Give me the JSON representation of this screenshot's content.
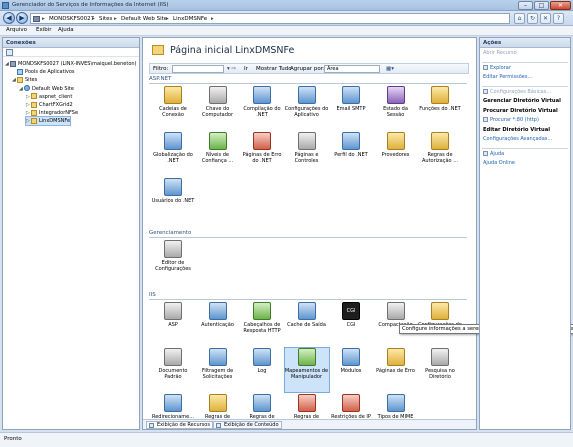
{
  "window": {
    "title": "Gerenciador do Serviços de Informações da Internet (IIS)"
  },
  "window_buttons": {
    "minimize": "–",
    "maximize": "□",
    "close": "✕"
  },
  "address": {
    "crumbs": [
      "MONDSKFS0027",
      "Sites",
      "Default Web Site",
      "LinxDMSNFe"
    ],
    "separator": "▸"
  },
  "menu": [
    "Arquivo",
    "Exibir",
    "Ajuda"
  ],
  "connections": {
    "title": "Conexões",
    "tree": [
      {
        "label": "MONDSKFS0027 (LINX-INVES\\maiquel.beneton)",
        "toggle": "◢",
        "icon": "server",
        "indent": 0
      },
      {
        "label": "Pools de Aplicativos",
        "toggle": "",
        "icon": "pools",
        "indent": 1
      },
      {
        "label": "Sites",
        "toggle": "◢",
        "icon": "folder",
        "indent": 1
      },
      {
        "label": "Default Web Site",
        "toggle": "◢",
        "icon": "globe",
        "indent": 2
      },
      {
        "label": "aspnet_client",
        "toggle": "▷",
        "icon": "folder",
        "indent": 3
      },
      {
        "label": "ChartFXGrid2",
        "toggle": "▷",
        "icon": "folder",
        "indent": 3
      },
      {
        "label": "IntegradorNFSe",
        "toggle": "▷",
        "icon": "folder",
        "indent": 3
      },
      {
        "label": "LinxDMSNFe",
        "toggle": "▷",
        "icon": "folder",
        "indent": 3,
        "selected": true
      }
    ]
  },
  "main": {
    "title": "Página inicial LinxDMSNFe",
    "filter_label": "Filtro:",
    "go_label": "Ir",
    "show_all_label": "Mostrar Tudo",
    "group_by_label": "Agrupar por:",
    "group_by_value": "Área",
    "groups": [
      {
        "name": "ASP.NET",
        "features": [
          {
            "label": "Cadeias de Conexão",
            "icon": "gold"
          },
          {
            "label": "Chave do Computador",
            "icon": "grey"
          },
          {
            "label": "Compilação do .NET",
            "icon": "blue"
          },
          {
            "label": "Configurações do Aplicativo",
            "icon": "blue"
          },
          {
            "label": "Email SMTP",
            "icon": "blue"
          },
          {
            "label": "Estado da Sessão",
            "icon": "purple"
          },
          {
            "label": "Funções do .NET",
            "icon": "gold"
          },
          {
            "label": "Globalização do .NET",
            "icon": "blue"
          },
          {
            "label": "Níveis de Confiança ...",
            "icon": "green"
          },
          {
            "label": "Páginas de Erro do .NET",
            "icon": "red"
          },
          {
            "label": "Páginas e Controles",
            "icon": "grey"
          },
          {
            "label": "Perfil do .NET",
            "icon": "blue"
          },
          {
            "label": "Provedores",
            "icon": "gold"
          },
          {
            "label": "Regras de Autorização ...",
            "icon": "gold"
          },
          {
            "label": "Usuários do .NET",
            "icon": "blue"
          }
        ]
      },
      {
        "name": "Gerenciamento",
        "features": [
          {
            "label": "Editor de Configurações",
            "icon": "grey"
          }
        ]
      },
      {
        "name": "IIS",
        "features": [
          {
            "label": "ASP",
            "icon": "grey"
          },
          {
            "label": "Autenticação",
            "icon": "blue"
          },
          {
            "label": "Cabeçalhos de Resposta HTTP",
            "icon": "green"
          },
          {
            "label": "Cache de Saída",
            "icon": "blue"
          },
          {
            "label": "CGI",
            "icon": "dark",
            "glyph": "CGI"
          },
          {
            "label": "Compactação",
            "icon": "grey"
          },
          {
            "label": "Configurações de SSL",
            "icon": "gold"
          },
          {
            "label": "Documento Padrão",
            "icon": "grey"
          },
          {
            "label": "Filtragem de Solicitações",
            "icon": "blue"
          },
          {
            "label": "Log",
            "icon": "blue"
          },
          {
            "label": "Mapeamentos de Manipulador",
            "icon": "green",
            "selected": true
          },
          {
            "label": "Módulos",
            "icon": "blue"
          },
          {
            "label": "Páginas de Erro",
            "icon": "gold"
          },
          {
            "label": "Pesquisa no Diretório",
            "icon": "grey"
          },
          {
            "label": "Redirecioname... HTTP",
            "icon": "blue"
          },
          {
            "label": "Regras de Autorização",
            "icon": "gold"
          },
          {
            "label": "Regras de Criação WebDAV",
            "icon": "blue"
          },
          {
            "label": "Regras de Rastreamento ...",
            "icon": "red"
          },
          {
            "label": "Restrições de IP e de Domínio",
            "icon": "red"
          },
          {
            "label": "Tipos de MIME",
            "icon": "blue"
          }
        ]
      }
    ],
    "tooltip": "Configure informações a serem exibidas em uma listagem de diretório",
    "view_tabs": [
      "Exibição de Recursos",
      "Exibição de Conteúdo"
    ]
  },
  "actions": {
    "title": "Ações",
    "items": [
      {
        "type": "link",
        "label": "Abrir Recurso",
        "disabled": true
      },
      {
        "type": "sep"
      },
      {
        "type": "link",
        "label": "Explorar",
        "icon": true
      },
      {
        "type": "link",
        "label": "Editar Permissões..."
      },
      {
        "type": "sep"
      },
      {
        "type": "link",
        "label": "Configurações Básicas...",
        "icon": true,
        "disabled": true
      },
      {
        "type": "head",
        "label": "Gerenciar Diretório Virtual"
      },
      {
        "type": "head",
        "label": "Procurar Diretório Virtual"
      },
      {
        "type": "link",
        "label": "Procurar *:80 (http)",
        "icon": true
      },
      {
        "type": "head",
        "label": "Editar Diretório Virtual"
      },
      {
        "type": "link",
        "label": "Configurações Avançadas..."
      },
      {
        "type": "sep"
      },
      {
        "type": "link",
        "label": "Ajuda",
        "icon": true
      },
      {
        "type": "link",
        "label": "Ajuda Online"
      }
    ]
  },
  "status": {
    "text": "Pronto"
  }
}
